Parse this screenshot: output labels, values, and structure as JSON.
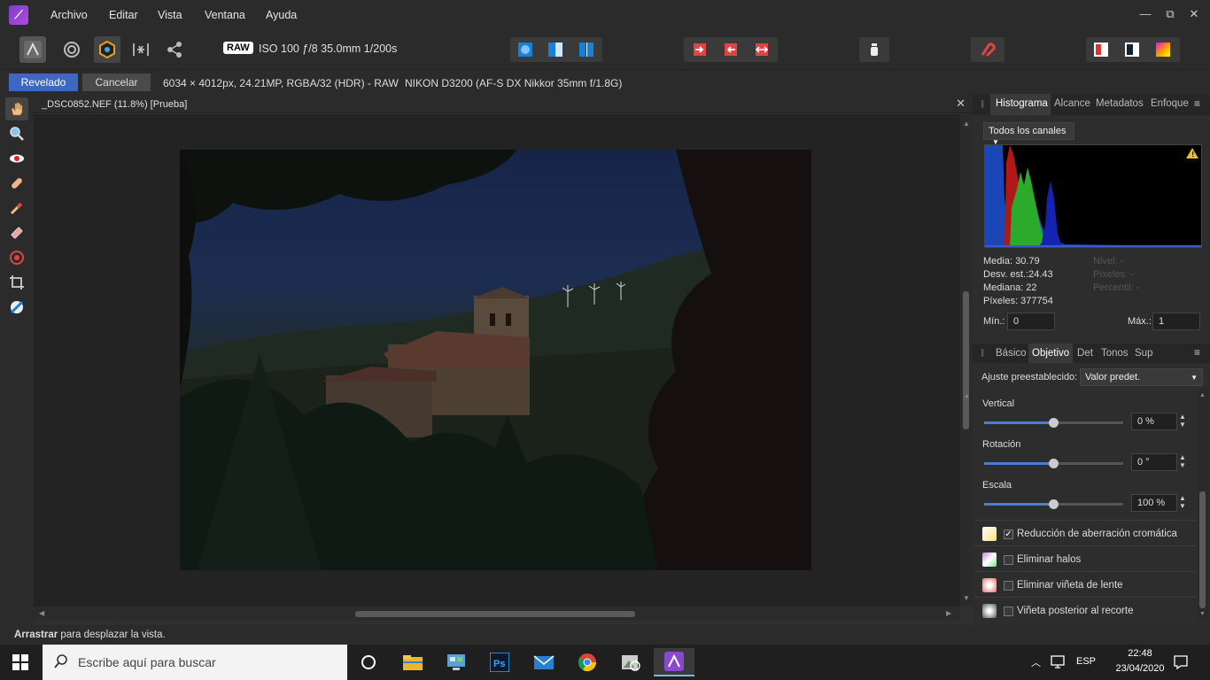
{
  "menubar": {
    "items": [
      "Archivo",
      "Editar",
      "Vista",
      "Ventana",
      "Ayuda"
    ],
    "win_min": "—",
    "win_max": "⧉",
    "win_close": "✕"
  },
  "toolbar": {
    "raw_badge": "RAW",
    "exif": "ISO 100 ƒ/8 35.0mm 1/200s"
  },
  "context": {
    "develop_button": "Revelado",
    "cancel_button": "Cancelar",
    "image_info": "6034 × 4012px, 24.21MP, RGBA/32 (HDR) - RAW",
    "camera_info": "NIKON D3200 (AF-S DX Nikkor 35mm f/1.8G)"
  },
  "document": {
    "title": "_DSC0852.NEF (11.8%) [Prueba]",
    "close": "✕"
  },
  "histogram_panel": {
    "tabs": [
      "Histograma",
      "Alcance",
      "Metadatos",
      "Enfoque"
    ],
    "channel_select": "Todos los canales",
    "stats": {
      "media": "Media: 30.79",
      "desv": "Desv. est.:24.43",
      "mediana": "Mediana: 22",
      "pixeles": "Píxeles: 377754",
      "nivel": "Nivel: -",
      "pixeles2": "Píxeles: -",
      "percentil": "Percentil: -"
    },
    "min_label": "Mín.:",
    "min_value": "0",
    "max_label": "Máx.:",
    "max_value": "1"
  },
  "adjust_panel": {
    "tabs": [
      "Básico",
      "Objetivo",
      "Det",
      "Tonos",
      "Sup"
    ],
    "preset_label": "Ajuste preestablecido:",
    "preset_value": "Valor predet.",
    "sliders": [
      {
        "label": "Vertical",
        "value": "0 %",
        "level": 0.5
      },
      {
        "label": "Rotación",
        "value": "0 °",
        "level": 0.5
      },
      {
        "label": "Escala",
        "value": "100 %",
        "level": 0.5
      }
    ],
    "checks": [
      {
        "label": "Reducción de aberración cromática",
        "checked": true
      },
      {
        "label": "Eliminar halos",
        "checked": false
      },
      {
        "label": "Eliminar viñeta de lente",
        "checked": false
      },
      {
        "label": "Viñeta posterior al recorte",
        "checked": false
      }
    ]
  },
  "status": {
    "bold": "Arrastrar",
    "text": " para desplazar la vista."
  },
  "taskbar": {
    "search_placeholder": "Escribe aquí para buscar",
    "lang": "ESP",
    "time": "22:48",
    "date": "23/04/2020"
  },
  "colors": {
    "accent": "#3e67c2",
    "slider": "#4d7bd6"
  }
}
